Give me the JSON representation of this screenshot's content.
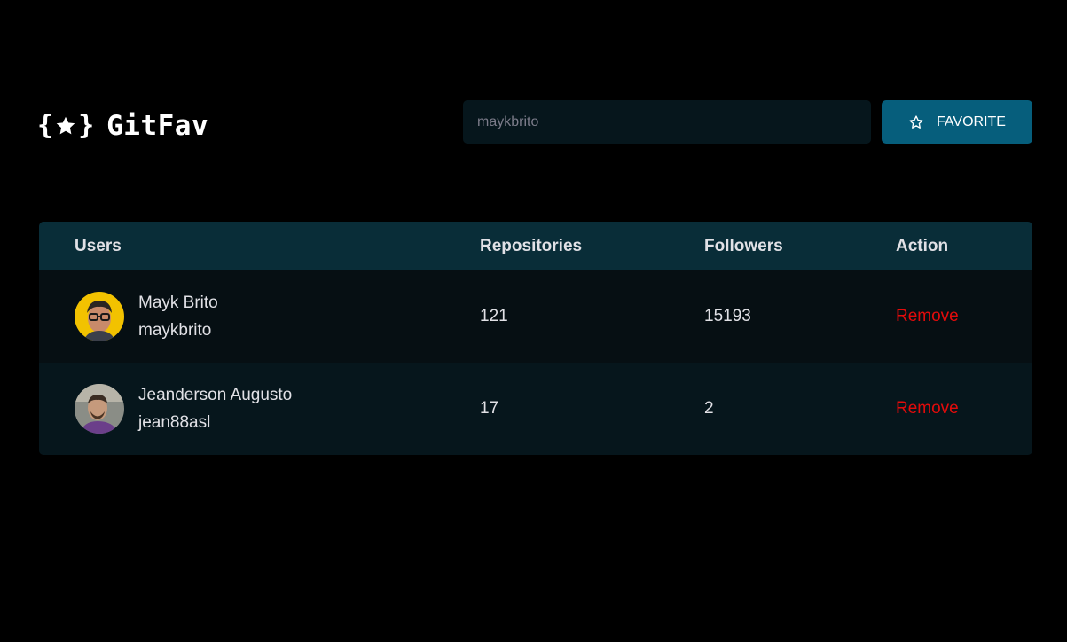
{
  "header": {
    "logo_name": "GitFav",
    "brace_open": "{",
    "brace_close": "}",
    "search_value": "maykbrito",
    "favorite_label": "FAVORITE"
  },
  "table": {
    "columns": [
      "Users",
      "Repositories",
      "Followers",
      "Action"
    ],
    "rows": [
      {
        "name": "Mayk Brito",
        "login": "maykbrito",
        "repositories": "121",
        "followers": "15193",
        "action": "Remove"
      },
      {
        "name": "Jeanderson Augusto",
        "login": "jean88asl",
        "repositories": "17",
        "followers": "2",
        "action": "Remove"
      }
    ]
  },
  "colors": {
    "background": "#000000",
    "accent": "#065e7c",
    "header_row": "#092d38",
    "remove": "#e30b0b"
  },
  "icons": {
    "logo": "star-in-braces-icon",
    "favorite": "star-outline-icon"
  }
}
